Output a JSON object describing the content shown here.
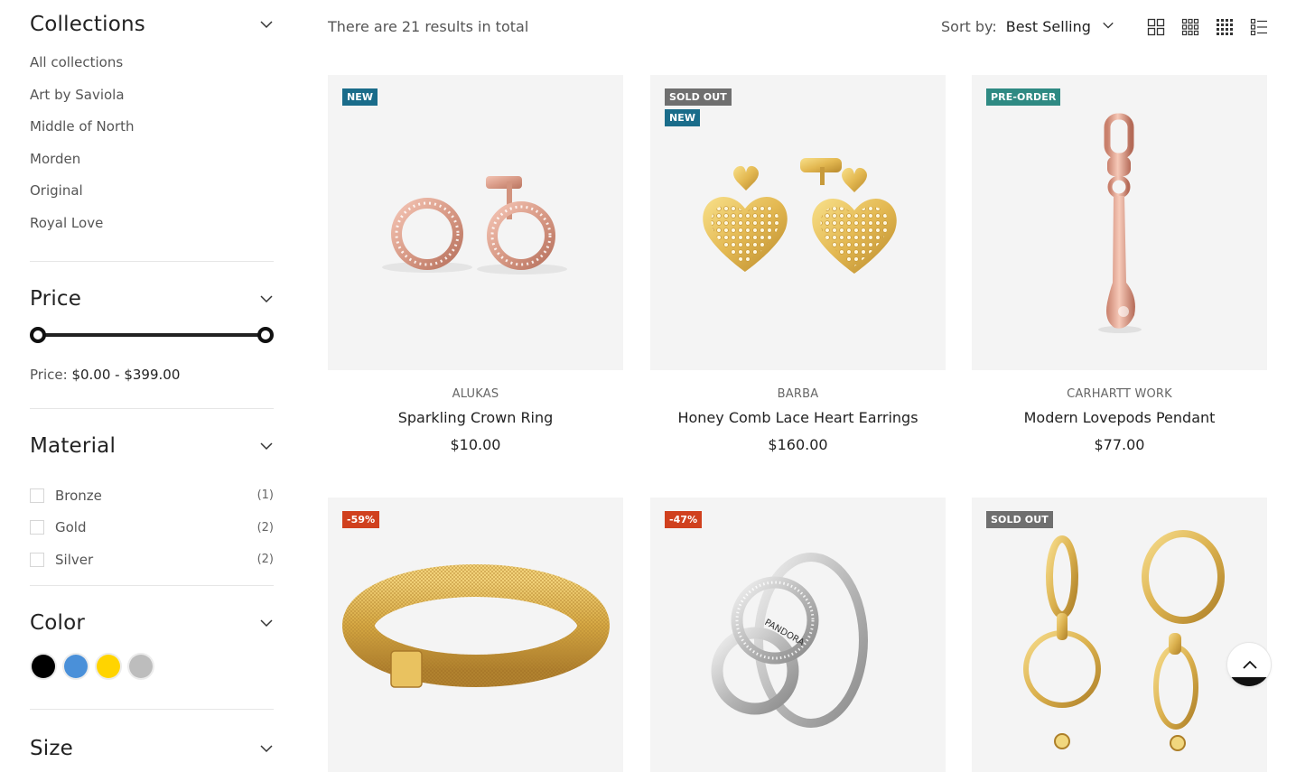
{
  "sidebar": {
    "collections": {
      "title": "Collections",
      "items": [
        "All collections",
        "Art by Saviola",
        "Middle of North",
        "Morden",
        "Original",
        "Royal Love"
      ]
    },
    "price": {
      "title": "Price",
      "label": "Price:",
      "range_text": "$0.00 - $399.00",
      "min_value": 0,
      "max_value": 399
    },
    "material": {
      "title": "Material",
      "items": [
        {
          "label": "Bronze",
          "count": "(1)"
        },
        {
          "label": "Gold",
          "count": "(2)"
        },
        {
          "label": "Silver",
          "count": "(2)"
        }
      ]
    },
    "color": {
      "title": "Color",
      "swatches": [
        "#000000",
        "#4a90d9",
        "#ffd400",
        "#bdbdbd"
      ]
    },
    "size": {
      "title": "Size"
    }
  },
  "topbar": {
    "results_text": "There are 21 results in total",
    "sort_label": "Sort by:",
    "sort_value": "Best Selling"
  },
  "products": [
    {
      "badges": [
        {
          "text": "NEW",
          "color": "#1a6c8a"
        }
      ],
      "brand": "ALUKAS",
      "name": "Sparkling Crown Ring",
      "price": "$10.00",
      "image": "rose-gold-circle-earrings"
    },
    {
      "badges": [
        {
          "text": "SOLD OUT",
          "color": "#6f6f6f"
        },
        {
          "text": "NEW",
          "color": "#1a6c8a"
        }
      ],
      "brand": "BARBA",
      "name": "Honey Comb Lace Heart Earrings",
      "price": "$160.00",
      "image": "gold-heart-earrings"
    },
    {
      "badges": [
        {
          "text": "PRE-ORDER",
          "color": "#2f8a83"
        }
      ],
      "brand": "CARHARTT WORK",
      "name": "Modern Lovepods Pendant",
      "price": "$77.00",
      "image": "rose-gold-pendant"
    },
    {
      "badges": [
        {
          "text": "-59%",
          "color": "#d0401e"
        }
      ],
      "brand": "",
      "name": "",
      "price": "",
      "image": "gold-mesh-bracelet"
    },
    {
      "badges": [
        {
          "text": "-47%",
          "color": "#d0401e"
        }
      ],
      "brand": "",
      "name": "",
      "price": "",
      "image": "silver-ring"
    },
    {
      "badges": [
        {
          "text": "SOLD OUT",
          "color": "#6f6f6f"
        }
      ],
      "brand": "",
      "name": "",
      "price": "",
      "image": "gold-hoop-earrings"
    }
  ],
  "ring_text": "PANDORA"
}
